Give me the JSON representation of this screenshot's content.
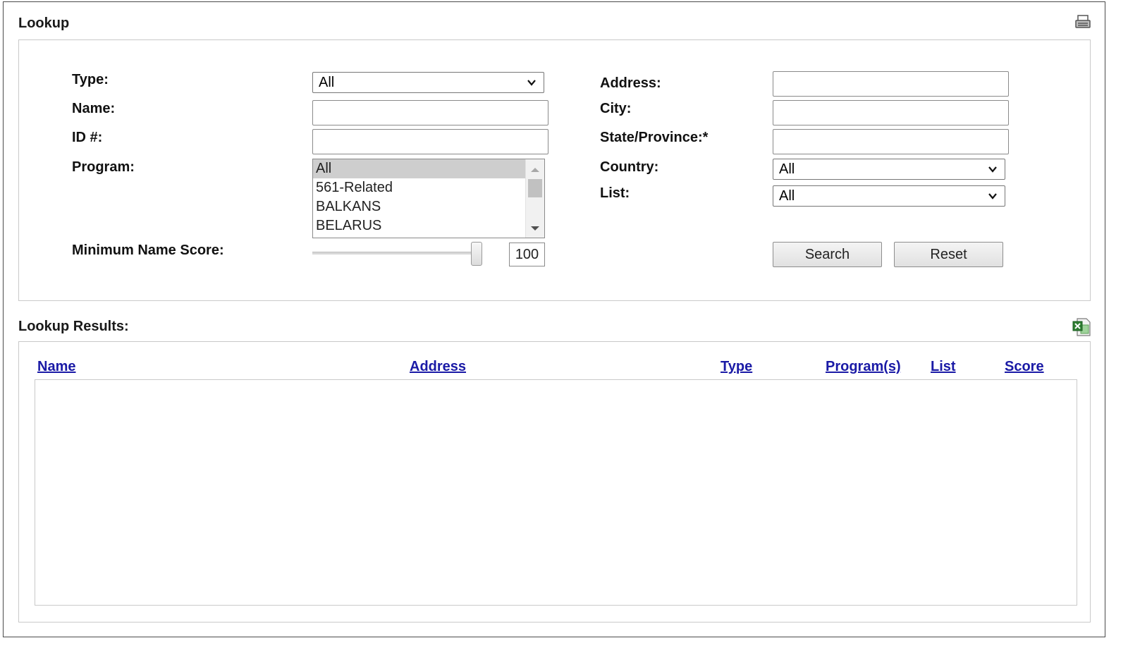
{
  "lookup": {
    "title": "Lookup",
    "print_icon": "printer-icon",
    "fields": {
      "type": {
        "label": "Type:",
        "value": "All"
      },
      "name": {
        "label": "Name:",
        "value": ""
      },
      "id": {
        "label": "ID #:",
        "value": ""
      },
      "program": {
        "label": "Program:",
        "options": [
          "All",
          "561-Related",
          "BALKANS",
          "BELARUS"
        ],
        "selected": "All"
      },
      "min_score": {
        "label": "Minimum Name Score:",
        "value": "100",
        "level_percent": 100
      },
      "address": {
        "label": "Address:",
        "value": ""
      },
      "city": {
        "label": "City:",
        "value": ""
      },
      "state": {
        "label": "State/Province:*",
        "value": ""
      },
      "country": {
        "label": "Country:",
        "value": "All"
      },
      "list": {
        "label": "List:",
        "value": "All"
      }
    },
    "buttons": {
      "search": "Search",
      "reset": "Reset"
    }
  },
  "results": {
    "title": "Lookup Results:",
    "export_icon": "excel-export-icon",
    "columns": [
      "Name",
      "Address",
      "Type",
      "Program(s)",
      "List",
      "Score"
    ],
    "rows": []
  },
  "colors": {
    "link": "#1a1aa6",
    "border": "#c9c9c9",
    "selected_option": "#cecece"
  }
}
